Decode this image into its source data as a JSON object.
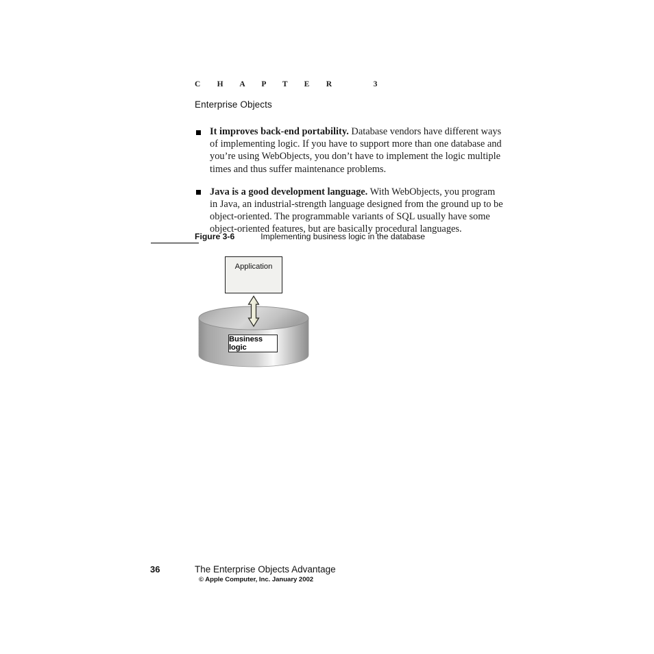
{
  "header": {
    "chapter_label": "C  H  A  P  T  E  R      3",
    "chapter_title": "Enterprise Objects"
  },
  "body": {
    "bullets": [
      {
        "lead": "It improves back-end portability.",
        "text": " Database vendors have different ways of implementing logic. If you have to support more than one database and you’re using WebObjects, you don’t have to implement the logic multiple times and thus suffer maintenance problems."
      },
      {
        "lead": "Java is a good development language.",
        "text": " With WebObjects, you program in Java, an industrial-strength language designed from the ground up to be object-oriented. The programmable variants of SQL usually have some object-oriented features, but are basically procedural languages."
      }
    ]
  },
  "figure": {
    "label": "Figure 3-6",
    "description": "Implementing business logic in the database",
    "diagram": {
      "application_box_label": "Application",
      "business_logic_box_label": "Business logic",
      "arrow": "double-headed-vertical-arrow",
      "cylinder": "database-cylinder",
      "colors": {
        "app_box_fill": "#f1f1ee",
        "box_stroke": "#1c1c1c",
        "arrow_fill": "#eeeedd",
        "cylinder_light": "#fbfbfb",
        "cylinder_mid": "#b9b9b9",
        "cylinder_dark": "#8f8f8f"
      }
    }
  },
  "footer": {
    "page_number": "36",
    "title": "The Enterprise Objects Advantage",
    "copyright": "© Apple Computer, Inc. January 2002"
  }
}
